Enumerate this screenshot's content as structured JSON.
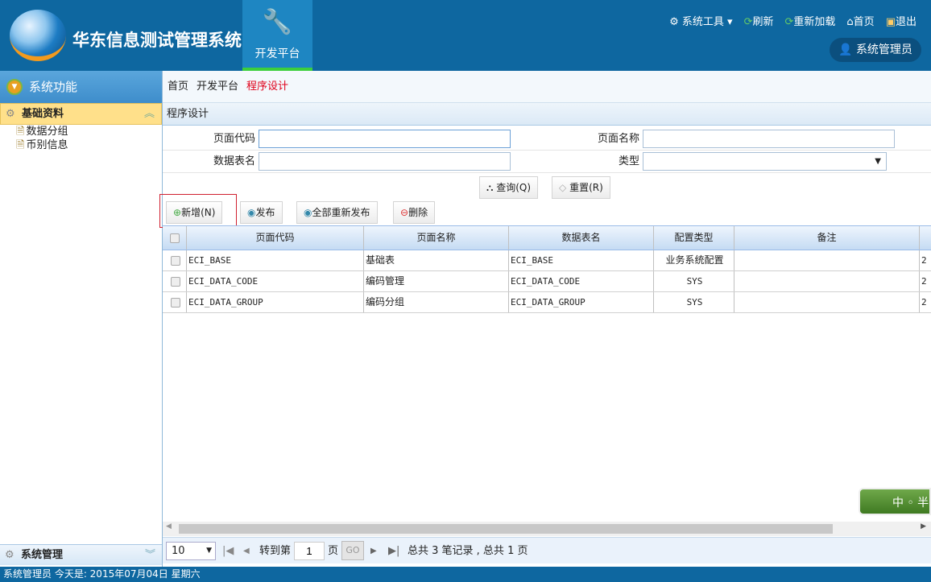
{
  "header": {
    "title": "华东信息测试管理系统",
    "dev_tab": "开发平台",
    "links": [
      "系统工具",
      "刷新",
      "重新加载",
      "首页",
      "退出"
    ],
    "user": "系统管理员"
  },
  "sidebar": {
    "title": "系统功能",
    "group": "基础资料",
    "items": [
      "数据分组",
      "币别信息"
    ],
    "bottom_group": "系统管理"
  },
  "breadcrumb": [
    "首页",
    "开发平台",
    "程序设计"
  ],
  "panel_title": "程序设计",
  "form": {
    "page_code_label": "页面代码",
    "page_code": "",
    "page_name_label": "页面名称",
    "page_name": "",
    "table_label": "数据表名",
    "table": "",
    "type_label": "类型",
    "type": "",
    "query": "查询(Q)",
    "reset": "重置(R)"
  },
  "toolbar": {
    "add": "新增(N)",
    "publish": "发布",
    "republish_all": "全部重新发布",
    "delete": "删除"
  },
  "grid": {
    "columns": [
      "页面代码",
      "页面名称",
      "数据表名",
      "配置类型",
      "备注"
    ],
    "rows": [
      [
        "ECI_BASE",
        "基础表",
        "ECI_BASE",
        "业务系统配置",
        "",
        "2"
      ],
      [
        "ECI_DATA_CODE",
        "编码管理",
        "ECI_DATA_CODE",
        "SYS",
        "",
        "2"
      ],
      [
        "ECI_DATA_GROUP",
        "编码分组",
        "ECI_DATA_GROUP",
        "SYS",
        "",
        "2"
      ]
    ]
  },
  "pager": {
    "page_size": "10",
    "goto": "转到第",
    "page": "1",
    "page_unit": "页",
    "go": "GO",
    "summary": "总共 3 笔记录 , 总共 1 页"
  },
  "footer": "系统管理员 今天是: 2015年07月04日 星期六",
  "badge": "中 ◦ 半"
}
